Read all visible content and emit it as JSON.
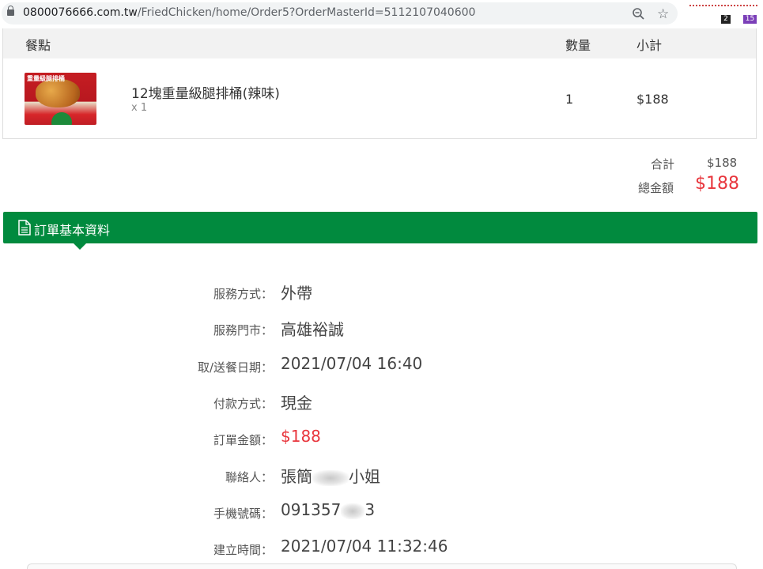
{
  "browser": {
    "url_host": "0800076666.com.tw",
    "url_path": "/FriedChicken/home/Order5?OrderMasterId=5112107040600",
    "extensions": [
      "2",
      "15"
    ]
  },
  "order_table": {
    "headers": {
      "item": "餐點",
      "qty": "數量",
      "subtotal": "小計"
    },
    "items": [
      {
        "image_text": "重量級腿排桶",
        "name": "12塊重量級腿排桶(辣味)",
        "qty_tag": "x 1",
        "qty": "1",
        "subtotal": "$188"
      }
    ]
  },
  "totals": {
    "sum_label": "合計",
    "sum_value": "$188",
    "grand_label": "總金額",
    "grand_value": "$188"
  },
  "section": {
    "title": "訂單基本資料",
    "icon": "document-icon"
  },
  "info": {
    "service_label": "服務方式：",
    "service_value": "外帶",
    "store_label": "服務門市：",
    "store_value": "高雄裕誠",
    "date_label": "取/送餐日期：",
    "date_value": "2021/07/04 16:40",
    "payment_label": "付款方式：",
    "payment_value": "現金",
    "amount_label": "訂單金額：",
    "amount_value": "$188",
    "contact_label": "聯絡人：",
    "contact_prefix": "張簡",
    "contact_suffix": "小姐",
    "phone_label": "手機號碼：",
    "phone_prefix": "091357",
    "phone_suffix": "3",
    "created_label": "建立時間：",
    "created_value": "2021/07/04 11:32:46"
  },
  "colors": {
    "brand_green": "#018a3e",
    "price_red": "#e8363d",
    "header_gray": "#f2f2f2"
  }
}
